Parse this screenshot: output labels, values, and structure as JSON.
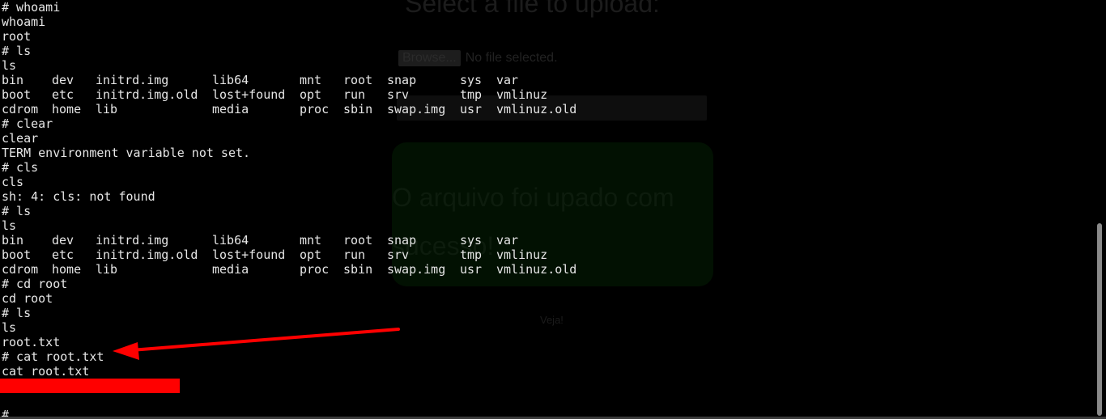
{
  "background_page": {
    "title": "Select a file to upload:",
    "browse_button": "Browse...",
    "browse_status": "No file selected.",
    "success_message": "O arquivo foi upado com sucesso!",
    "link": "Veja!"
  },
  "terminal": {
    "block1": [
      "# whoami",
      "whoami",
      "root",
      "# ls",
      "ls"
    ],
    "ls_first": [
      [
        "bin",
        "dev",
        "initrd.img",
        "lib64",
        "mnt",
        "root",
        "snap",
        "sys",
        "var"
      ],
      [
        "boot",
        "etc",
        "initrd.img.old",
        "lost+found",
        "opt",
        "run",
        "srv",
        "tmp",
        "vmlinuz"
      ],
      [
        "cdrom",
        "home",
        "lib",
        "",
        "media",
        "proc",
        "sbin",
        "swap.img",
        "usr",
        "vmlinuz.old"
      ]
    ],
    "block2": [
      "# clear",
      "clear",
      "TERM environment variable not set.",
      "# cls",
      "cls",
      "sh: 4: cls: not found",
      "# ls",
      "ls"
    ],
    "ls_second": [
      [
        "bin",
        "dev",
        "initrd.img",
        "lib64",
        "mnt",
        "root",
        "snap",
        "sys",
        "var"
      ],
      [
        "boot",
        "etc",
        "initrd.img.old",
        "lost+found",
        "opt",
        "run",
        "srv",
        "tmp",
        "vmlinuz"
      ],
      [
        "cdrom",
        "home",
        "lib",
        "",
        "media",
        "proc",
        "sbin",
        "swap.img",
        "usr",
        "vmlinuz.old"
      ]
    ],
    "block3": [
      "# cd root",
      "cd root",
      "# ls",
      "ls",
      "root.txt",
      "# cat root.txt",
      "cat root.txt"
    ],
    "final_prompt": "#"
  },
  "colors": {
    "terminal_background": "#000000",
    "terminal_text": "#e6e6e6",
    "annotation_arrow": "#ff0000",
    "redaction": "#ff0000"
  }
}
